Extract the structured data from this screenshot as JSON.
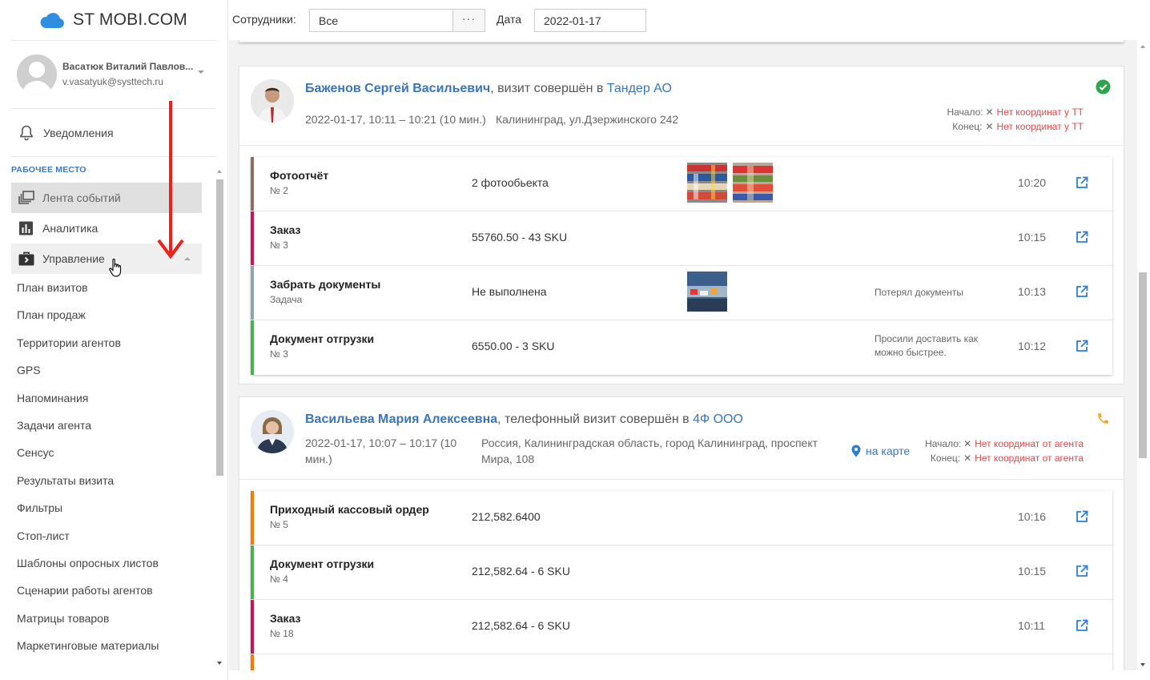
{
  "app": {
    "logo_text": "ST MOBI.COM"
  },
  "user": {
    "name": "Васатюк Виталий Павлов...",
    "email": "v.vasatyuk@systtech.ru"
  },
  "notifications": {
    "label": "Уведомления"
  },
  "workspace": {
    "section_label": "РАБОЧЕЕ МЕСТО",
    "items": [
      {
        "label": "Лента событий",
        "icon": "feed-icon"
      },
      {
        "label": "Аналитика",
        "icon": "analytics-icon"
      },
      {
        "label": "Управление",
        "icon": "briefcase-icon"
      }
    ],
    "submenu": [
      "План визитов",
      "План продаж",
      "Территории агентов",
      "GPS",
      "Напоминания",
      "Задачи агента",
      "Сенсус",
      "Результаты визита",
      "Фильтры",
      "Стоп-лист",
      "Шаблоны опросных листов",
      "Сценарии работы агентов",
      "Матрицы товаров",
      "Маркетинговые материалы"
    ]
  },
  "filters": {
    "employees_label": "Сотрудники:",
    "employees_value": "Все",
    "more_label": "···",
    "date_label": "Дата",
    "date_value": "2022-01-17"
  },
  "visits": [
    {
      "agent": "Баженов Сергей Васильевич",
      "action": ", визит совершён в ",
      "company": "Тандер АО",
      "when": "2022-01-17, 10:11 – 10:21 (10 мин.)",
      "address": "Калининград, ул.Дзержинского 242",
      "start_label": "Начало:",
      "start_value": "Нет координат у ТТ",
      "end_label": "Конец:",
      "end_value": "Нет координат у ТТ",
      "status_icon": "check-circle-icon",
      "status_color": "#2ea44f",
      "documents": [
        {
          "title": "Фотоотчёт",
          "sub": "№ 2",
          "value": "2 фотообьекта",
          "note": "",
          "time": "10:20",
          "color": "#8d6e63"
        },
        {
          "title": "Заказ",
          "sub": "№ 3",
          "value": "55760.50 - 43 SKU",
          "note": "",
          "time": "10:15",
          "color": "#c2185b"
        },
        {
          "title": "Забрать документы",
          "sub": "Задача",
          "value": "Не выполнена",
          "note": "Потерял документы",
          "time": "10:13",
          "color": "#90a4ae"
        },
        {
          "title": "Документ отгрузки",
          "sub": "№ 3",
          "value": "6550.00 - 3 SKU",
          "note": "Просили доставить как можно быстрее.",
          "time": "10:12",
          "color": "#4caf50"
        }
      ]
    },
    {
      "agent": "Васильева Мария Алексеевна",
      "action": ", телефонный визит совершён в ",
      "company": "4Ф ООО",
      "when": "2022-01-17, 10:07 – 10:17 (10 мин.)",
      "address": "Россия, Калининградская область, город Калининград, проспект Мира, 108",
      "map_link": "на карте",
      "start_label": "Начало:",
      "start_value": "Нет координат от агента",
      "end_label": "Конец:",
      "end_value": "Нет координат от агента",
      "status_icon": "phone-icon",
      "status_color": "#f5a623",
      "documents": [
        {
          "title": "Приходный кассовый ордер",
          "sub": "№ 5",
          "value": "212,582.6400",
          "note": "",
          "time": "10:16",
          "color": "#f57c00"
        },
        {
          "title": "Документ отгрузки",
          "sub": "№ 4",
          "value": "212,582.64 - 6 SKU",
          "note": "",
          "time": "10:15",
          "color": "#4caf50"
        },
        {
          "title": "Заказ",
          "sub": "№ 18",
          "value": "212,582.64 - 6 SKU",
          "note": "",
          "time": "10:11",
          "color": "#c2185b"
        }
      ]
    }
  ]
}
